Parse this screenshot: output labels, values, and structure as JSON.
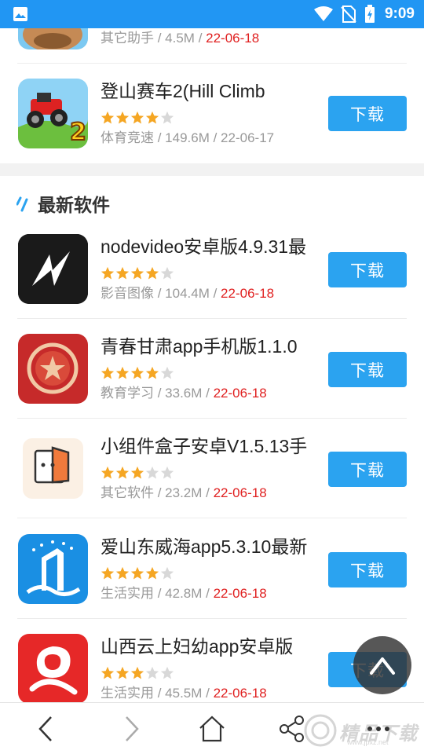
{
  "status_bar": {
    "time": "9:09",
    "background": "#2196f3",
    "icons": [
      "gallery-icon",
      "wifi-icon",
      "no-sim-icon",
      "battery-charging-icon"
    ]
  },
  "partial_top": {
    "meta_category": "其它助手",
    "meta_size": "4.5M",
    "meta_date": "22-06-18"
  },
  "featured": {
    "title": "登山赛车2(Hill Climb",
    "rating": 4,
    "category": "体育竞速",
    "size": "149.6M",
    "date": "22-06-17",
    "button": "下载"
  },
  "section": {
    "title": "最新软件",
    "accent_color": "#2ba3f0"
  },
  "apps": [
    {
      "title": "nodevideo安卓版4.9.31最",
      "rating": 4,
      "category": "影音图像",
      "size": "104.4M",
      "date": "22-06-18",
      "button": "下载",
      "icon": "nodevideo-icon"
    },
    {
      "title": "青春甘肃app手机版1.1.0",
      "rating": 4,
      "category": "教育学习",
      "size": "33.6M",
      "date": "22-06-18",
      "button": "下载",
      "icon": "youth-gansu-icon"
    },
    {
      "title": "小组件盒子安卓V1.5.13手",
      "rating": 3,
      "category": "其它软件",
      "size": "23.2M",
      "date": "22-06-18",
      "button": "下载",
      "icon": "widget-box-icon"
    },
    {
      "title": "爱山东威海app5.3.10最新",
      "rating": 4,
      "category": "生活实用",
      "size": "42.8M",
      "date": "22-06-18",
      "button": "下载",
      "icon": "ai-shandong-icon"
    },
    {
      "title": "山西云上妇幼app安卓版",
      "rating": 3,
      "category": "生活实用",
      "size": "45.5M",
      "date": "22-06-18",
      "button": "下载",
      "icon": "shanxi-maternal-icon"
    }
  ],
  "partial_button": "下载",
  "bottom_nav": [
    "back-icon",
    "forward-icon",
    "home-icon",
    "share-icon",
    "more-icon"
  ],
  "watermark": {
    "text": "精品下载",
    "url": "www.jpxz.net"
  },
  "colors": {
    "button": "#2ba3f0",
    "date_red": "#e02020",
    "star_on": "#f5a623",
    "star_off": "#d8d8d8"
  }
}
